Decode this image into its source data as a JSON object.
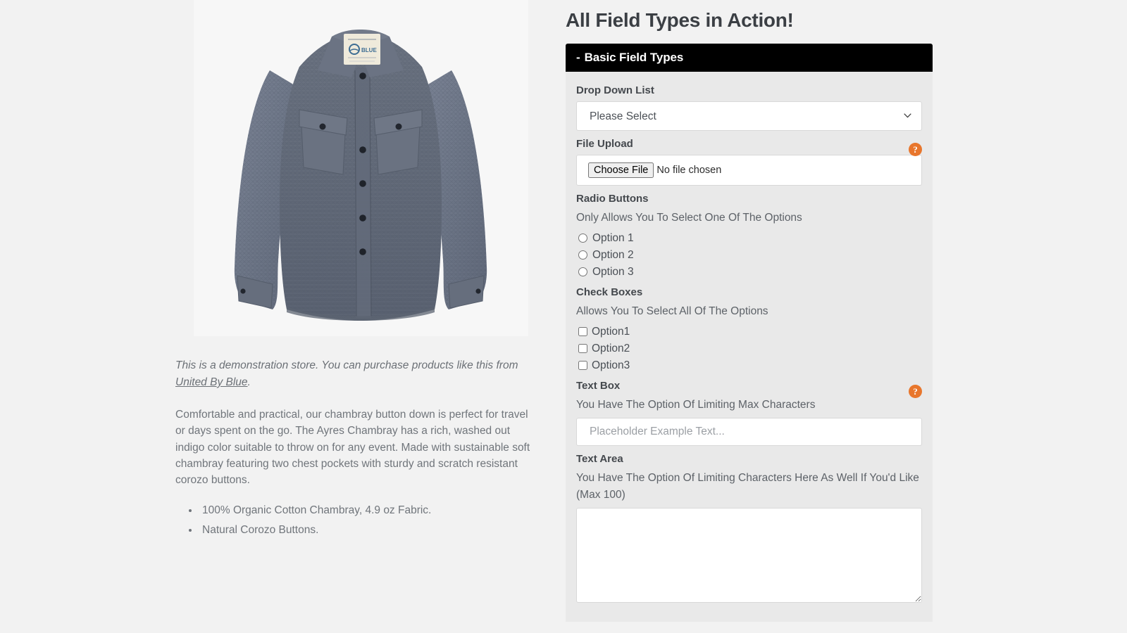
{
  "page": {
    "background_color": "#f2f2f2",
    "accent_color": "#e8762c",
    "header_bg_color": "#000000",
    "panel_bg_color": "#e9e9e9"
  },
  "product": {
    "image_alt": "Chambray button down shirt laid flat, washed indigo",
    "demo_note_prefix": "This is a demonstration store. You can purchase products like this from ",
    "demo_note_link": "United By Blue",
    "demo_note_suffix": ".",
    "description": "Comfortable and practical, our chambray button down is perfect for travel or days spent on the go. The Ayres Chambray has a rich, washed out indigo color suitable to throw on for any event. Made with sustainable soft chambray featuring two chest pockets with sturdy and scratch resistant corozo buttons.",
    "features": [
      "100% Organic Cotton Chambray, 4.9 oz Fabric.",
      "Natural Corozo Buttons."
    ]
  },
  "form": {
    "title": "All Field Types in Action!",
    "section": {
      "toggle": "-",
      "label": "Basic Field Types"
    },
    "dropdown": {
      "label": "Drop Down List",
      "selected": "Please Select",
      "options": [
        "Please Select"
      ],
      "chevron_icon": "chevron-down-icon"
    },
    "file_upload": {
      "label": "File Upload",
      "button_label": "Choose File",
      "status_text": "No file chosen",
      "help_icon": "?"
    },
    "radio": {
      "label": "Radio Buttons",
      "sub": "Only Allows You To Select One Of The Options",
      "options": [
        "Option 1",
        "Option 2",
        "Option 3"
      ],
      "selected": null
    },
    "checkbox": {
      "label": "Check Boxes",
      "sub": "Allows You To Select All Of The Options",
      "options": [
        "Option1",
        "Option2",
        "Option3"
      ],
      "checked": []
    },
    "textbox": {
      "label": "Text Box",
      "sub": "You Have The Option Of Limiting Max Characters",
      "value": "",
      "placeholder": "Placeholder Example Text...",
      "help_icon": "?"
    },
    "textarea": {
      "label": "Text Area",
      "sub": "You Have The Option Of Limiting Characters Here As Well If You'd Like (Max 100)",
      "value": "",
      "placeholder": ""
    }
  }
}
